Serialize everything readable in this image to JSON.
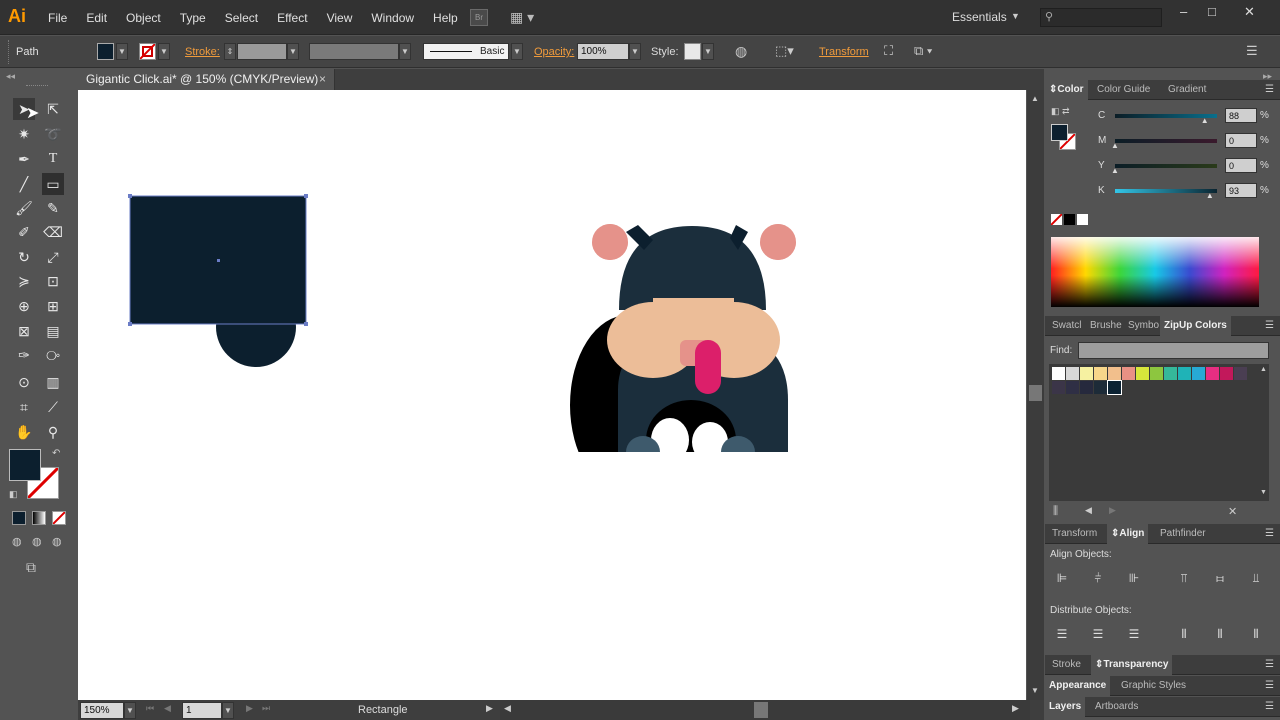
{
  "app": {
    "logo": "Ai",
    "window_buttons": [
      "‒",
      "□",
      "✕"
    ]
  },
  "menu": [
    "File",
    "Edit",
    "Object",
    "Type",
    "Select",
    "Effect",
    "View",
    "Window",
    "Help"
  ],
  "bridge_label": "Br",
  "workspace": "Essentials",
  "control_bar": {
    "selection_type": "Path",
    "stroke_label": "Stroke:",
    "brush_label": "Basic",
    "opacity_label": "Opacity:",
    "opacity_value": "100%",
    "style_label": "Style:",
    "transform_label": "Transform"
  },
  "document_tab": {
    "title": "Gigantic Click.ai* @ 150% (CMYK/Preview)",
    "close": "×"
  },
  "status_bar": {
    "zoom": "150%",
    "artboard": "1",
    "tool_name": "Rectangle"
  },
  "color_panel": {
    "tabs": [
      "Color",
      "Color Guide",
      "Gradient"
    ],
    "channels": [
      {
        "label": "C",
        "value": "88",
        "fraction": 0.88
      },
      {
        "label": "M",
        "value": "0",
        "fraction": 0.0
      },
      {
        "label": "Y",
        "value": "0",
        "fraction": 0.0
      },
      {
        "label": "K",
        "value": "93",
        "fraction": 0.93
      }
    ],
    "unit": "%"
  },
  "swatch_panel": {
    "tabs": [
      "Swatcl",
      "Brushe",
      "Symbo",
      "ZipUp Colors"
    ],
    "find_label": "Find:",
    "swatches": [
      "#ffffff",
      "#d8d8d8",
      "#f6f1a1",
      "#f7d68a",
      "#f2bf8c",
      "#e99184",
      "#d7e63b",
      "#8dc63f",
      "#35b89a",
      "#1fb3b7",
      "#27aad5",
      "#e72e82",
      "#c2185b",
      "#4a3e52",
      "#3b3548",
      "#2f2f45",
      "#26293d",
      "#1d2b38",
      "#0b2233"
    ]
  },
  "align_panel": {
    "tabs": [
      "Transform",
      "Align",
      "Pathfinder"
    ],
    "align_objects_label": "Align Objects:",
    "distribute_objects_label": "Distribute Objects:"
  },
  "bottom_panels": [
    {
      "tabs": [
        "Stroke",
        "Transparency"
      ]
    },
    {
      "tabs": [
        "Appearance",
        "Graphic Styles"
      ]
    },
    {
      "tabs": [
        "Layers",
        "Artboards"
      ]
    }
  ],
  "colors": {
    "fill": "#0c1f2e",
    "dog_body": "#1b2e3c",
    "dog_face": "#ecbd98",
    "ear": "#e5928a",
    "tongue": "#dc1f6a",
    "paw": "#3e5a6c",
    "accent": "#f09b3c"
  }
}
